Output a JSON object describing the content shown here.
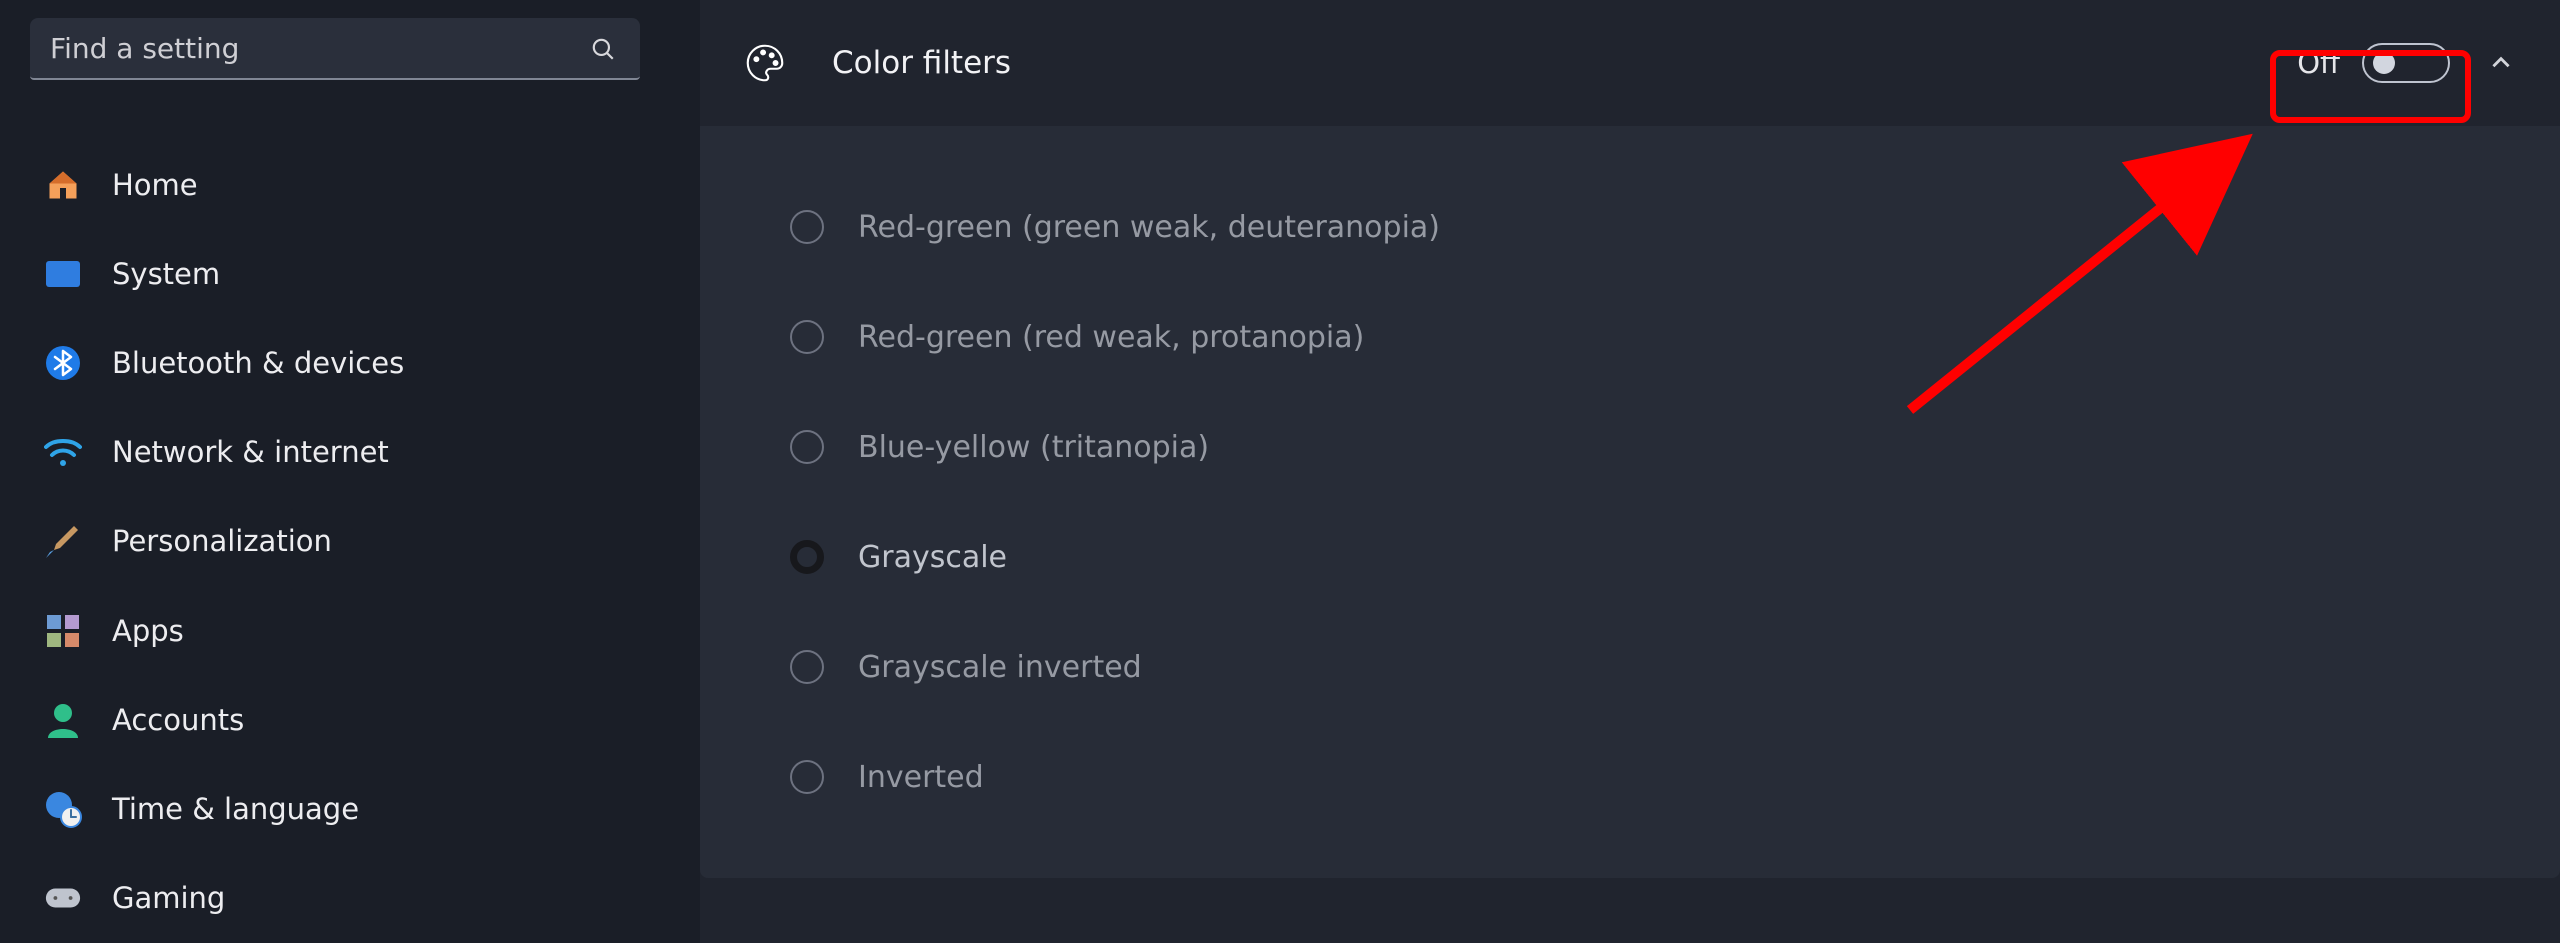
{
  "search": {
    "placeholder": "Find a setting"
  },
  "sidebar": {
    "items": [
      {
        "label": "Home",
        "icon": "home-icon"
      },
      {
        "label": "System",
        "icon": "system-icon"
      },
      {
        "label": "Bluetooth & devices",
        "icon": "bluetooth-icon"
      },
      {
        "label": "Network & internet",
        "icon": "wifi-icon"
      },
      {
        "label": "Personalization",
        "icon": "paintbrush-icon"
      },
      {
        "label": "Apps",
        "icon": "apps-icon"
      },
      {
        "label": "Accounts",
        "icon": "person-icon"
      },
      {
        "label": "Time & language",
        "icon": "clock-globe-icon"
      },
      {
        "label": "Gaming",
        "icon": "gamepad-icon"
      }
    ]
  },
  "main": {
    "title": "Color filters",
    "toggle": {
      "state": "Off"
    },
    "options": [
      {
        "label": "Red-green (green weak, deuteranopia)",
        "selected": false
      },
      {
        "label": "Red-green (red weak, protanopia)",
        "selected": false
      },
      {
        "label": "Blue-yellow (tritanopia)",
        "selected": false
      },
      {
        "label": "Grayscale",
        "selected": true
      },
      {
        "label": "Grayscale inverted",
        "selected": false
      },
      {
        "label": "Inverted",
        "selected": false
      }
    ]
  },
  "annotation": {
    "highlight": "toggle",
    "arrow_to": "toggle"
  }
}
